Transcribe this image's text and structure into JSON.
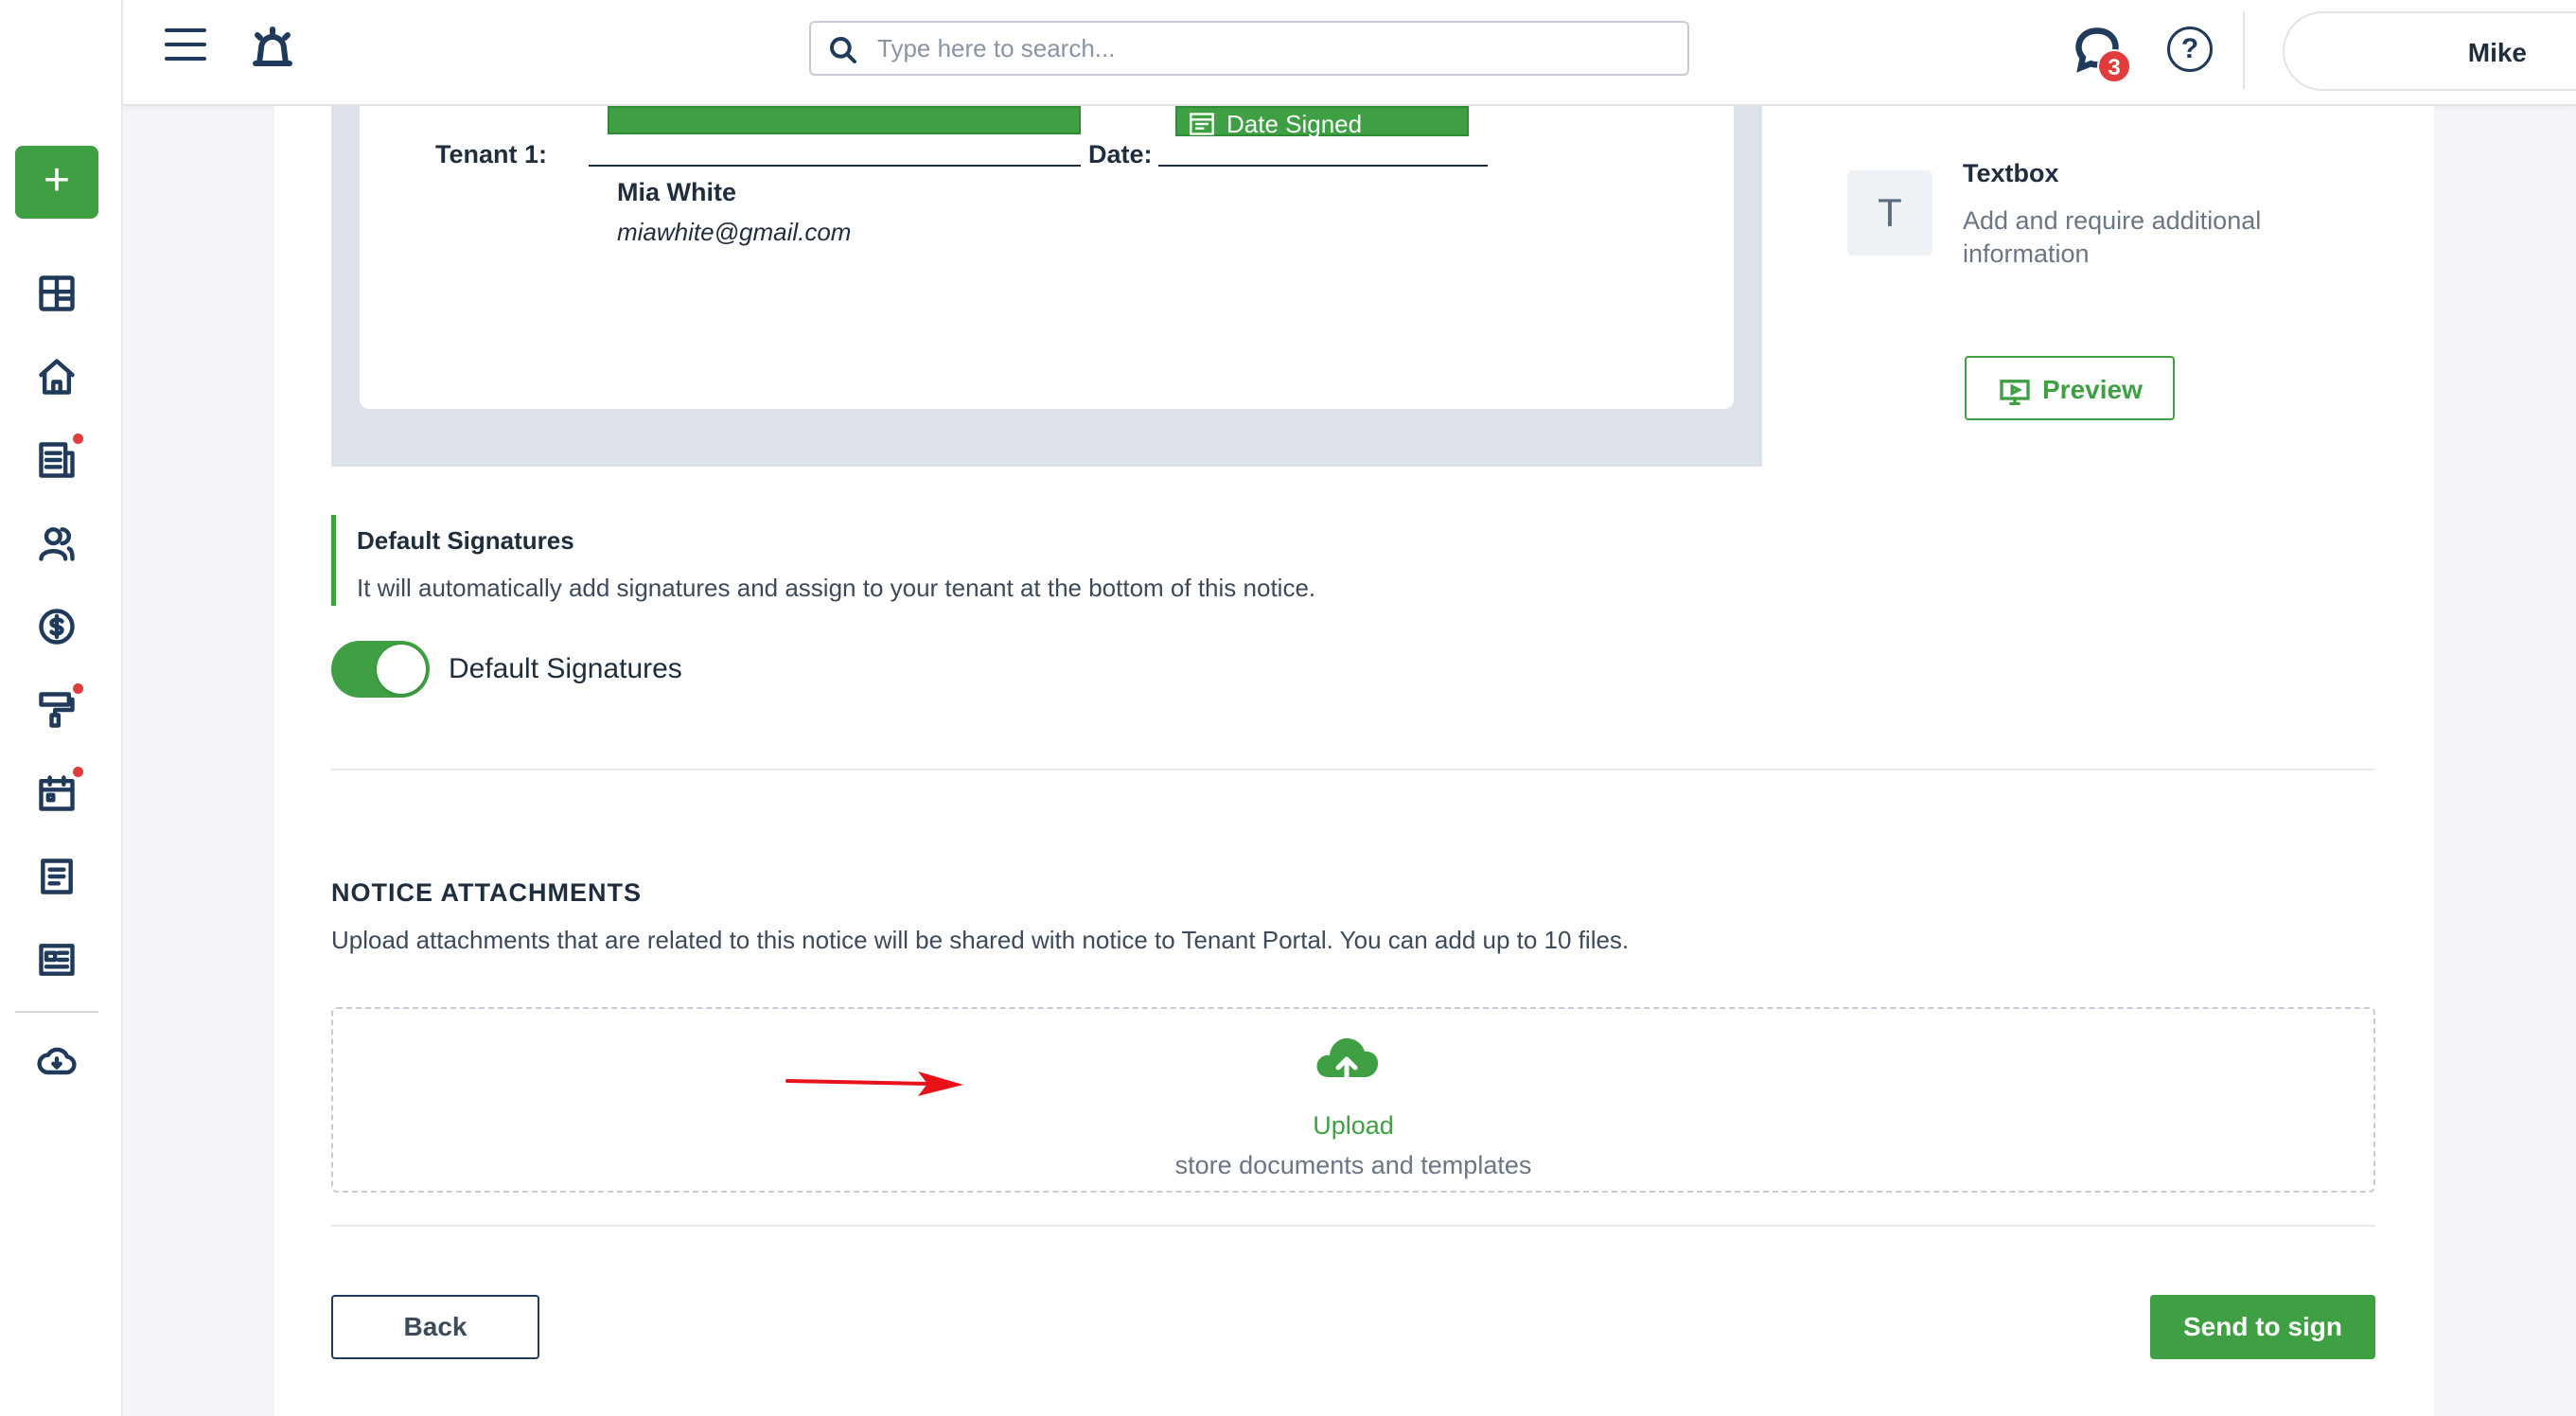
{
  "header": {
    "search_placeholder": "Type here to search...",
    "notification_count": "3",
    "help_glyph": "?",
    "user_name": "Mike"
  },
  "sidebar": {
    "add_glyph": "+",
    "items": [
      {
        "icon": "dashboard-icon",
        "dot": false
      },
      {
        "icon": "home-icon",
        "dot": false
      },
      {
        "icon": "reports-icon",
        "dot": true
      },
      {
        "icon": "people-icon",
        "dot": false
      },
      {
        "icon": "dollar-icon",
        "dot": false
      },
      {
        "icon": "maintenance-icon",
        "dot": true
      },
      {
        "icon": "calendar-icon",
        "dot": true
      },
      {
        "icon": "document-icon",
        "dot": false
      },
      {
        "icon": "listing-icon",
        "dot": false
      },
      {
        "icon": "download-icon",
        "dot": false
      }
    ]
  },
  "document": {
    "tenant_label": "Tenant 1:",
    "date_label": "Date:",
    "date_chip": "Date Signed",
    "tenant_name": "Mia White",
    "tenant_email": "miawhite@gmail.com"
  },
  "textbox_panel": {
    "icon_glyph": "T",
    "title": "Textbox",
    "description": "Add and require additional information",
    "preview_label": "Preview"
  },
  "default_signatures": {
    "title": "Default Signatures",
    "description": "It will automatically add signatures and assign to your tenant at the bottom of this notice.",
    "toggle_label": "Default Signatures",
    "toggle_on": true
  },
  "notice_attachments": {
    "title": "NOTICE ATTACHMENTS",
    "description": "Upload attachments that are related to this notice will be shared with notice to Tenant Portal. You can add up to 10 files.",
    "upload_label": "Upload",
    "upload_sub": "store documents and templates"
  },
  "footer": {
    "back_label": "Back",
    "send_label": "Send to sign"
  },
  "colors": {
    "accent": "#3ea043",
    "badge": "#e23b3b",
    "navy": "#1f3a5a"
  }
}
